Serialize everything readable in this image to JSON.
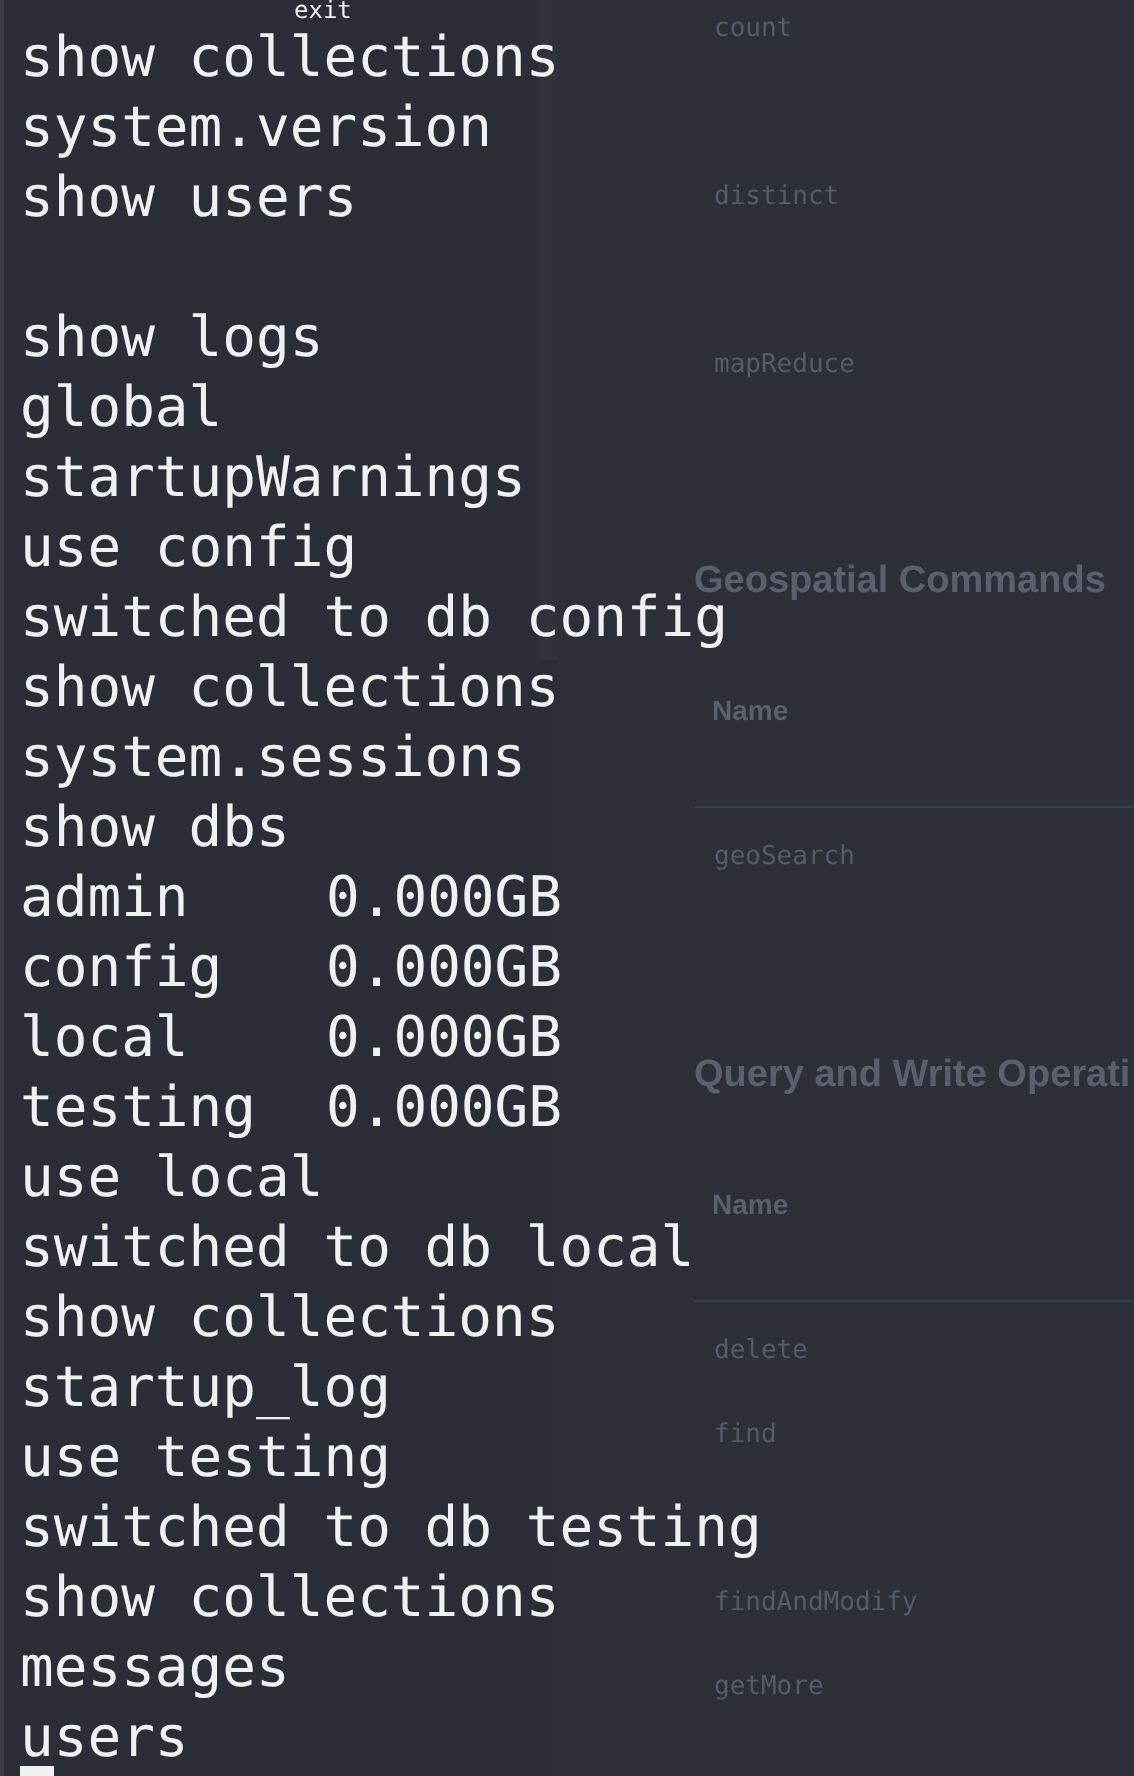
{
  "docs": {
    "top_rows": [
      "count",
      "distinct",
      "mapReduce"
    ],
    "sections": [
      {
        "title": "Geospatial Commands",
        "column_header": "Name",
        "rows": [
          "geoSearch"
        ]
      },
      {
        "title": "Query and Write Operati",
        "column_header": "Name",
        "rows": [
          "delete",
          "find",
          "findAndModify",
          "getMore"
        ]
      }
    ]
  },
  "terminal": {
    "lines": [
      {
        "kind": "indented",
        "text": "exit"
      },
      {
        "kind": "plain",
        "text": "show collections"
      },
      {
        "kind": "plain",
        "text": "system.version"
      },
      {
        "kind": "plain",
        "text": "show users"
      },
      {
        "kind": "blank"
      },
      {
        "kind": "plain",
        "text": "show logs"
      },
      {
        "kind": "plain",
        "text": "global"
      },
      {
        "kind": "plain",
        "text": "startupWarnings"
      },
      {
        "kind": "plain",
        "text": "use config"
      },
      {
        "kind": "plain",
        "text": "switched to db config"
      },
      {
        "kind": "plain",
        "text": "show collections"
      },
      {
        "kind": "plain",
        "text": "system.sessions"
      },
      {
        "kind": "plain",
        "text": "show dbs"
      },
      {
        "kind": "db",
        "name": "admin",
        "size": "0.000GB"
      },
      {
        "kind": "db",
        "name": "config",
        "size": "0.000GB"
      },
      {
        "kind": "db",
        "name": "local",
        "size": "0.000GB"
      },
      {
        "kind": "db",
        "name": "testing",
        "size": "0.000GB"
      },
      {
        "kind": "plain",
        "text": "use local"
      },
      {
        "kind": "plain",
        "text": "switched to db local"
      },
      {
        "kind": "plain",
        "text": "show collections"
      },
      {
        "kind": "plain",
        "text": "startup_log"
      },
      {
        "kind": "plain",
        "text": "use testing"
      },
      {
        "kind": "plain",
        "text": "switched to db testing"
      },
      {
        "kind": "plain",
        "text": "show collections"
      },
      {
        "kind": "plain",
        "text": "messages"
      },
      {
        "kind": "plain",
        "text": "users"
      },
      {
        "kind": "cursor"
      }
    ]
  }
}
